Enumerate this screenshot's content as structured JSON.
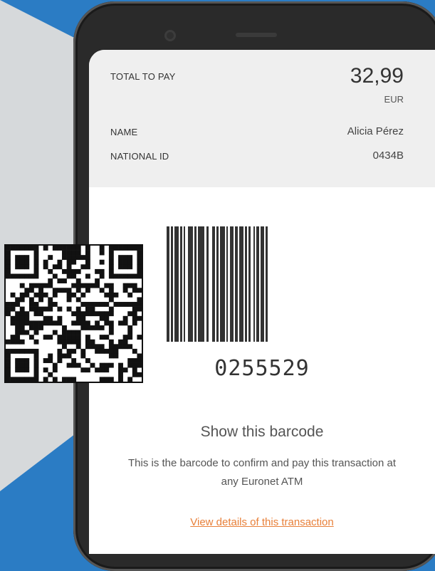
{
  "payment": {
    "total_label": "TOTAL TO PAY",
    "total_value": "32,99",
    "currency": "EUR",
    "name_label": "NAME",
    "name_value": "Alicia Pérez",
    "national_id_label": "NATIONAL ID",
    "national_id_value": "0434B"
  },
  "barcode": {
    "number": "0255529"
  },
  "instructions": {
    "heading": "Show this barcode",
    "description": "This is the barcode to confirm and pay this transaction at any Euronet ATM",
    "link": "View details of this transaction"
  },
  "colors": {
    "background_blue": "#2b7cc4",
    "background_gray": "#d6d9db",
    "link_orange": "#e8803a"
  },
  "icons": [
    "camera-icon",
    "speaker-icon",
    "qr-code-icon"
  ]
}
